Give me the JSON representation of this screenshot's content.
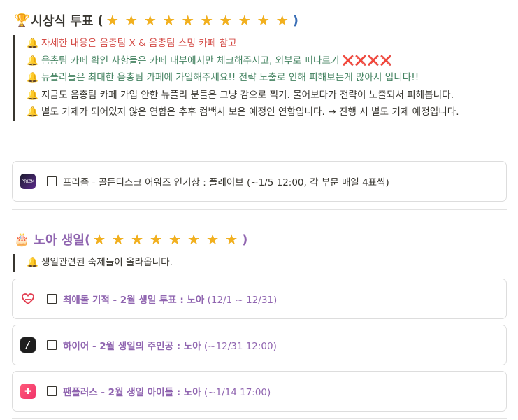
{
  "section1": {
    "emoji": "🏆",
    "title": "시상식 투표",
    "paren_open": "(",
    "paren_close": ")",
    "star_count": 10
  },
  "notes1": [
    {
      "text": "자세한 내용은 음총팀 X & 음총팀 스밍 카페 참고",
      "color": "red"
    },
    {
      "text": "음총팀 카페 확인 사항들은 카페 내부에서만 체크해주시고, 외부로 퍼나르기 ",
      "suffix": "❌❌❌❌",
      "color": "green"
    },
    {
      "text": "뉴플리들은 최대한 음총팀 카페에 가입해주세요!! 전략 노출로 인해 피해보는게 많아서 입니다!!",
      "color": "green"
    },
    {
      "text": "지금도 음총팀 카페 가입 안한 뉴플리 분들은 그냥 감으로 찍기. 물어보다가 전략이 노출되서 피해봅니다.",
      "color": "dark"
    },
    {
      "text": "별도 기제가 되어있지 않은 연합은 추후 컴백시 보은 예정인 연합입니다. → 진행 시 별도 기제 예정입니다.",
      "color": "dark"
    }
  ],
  "card1": {
    "app": "PRIZM",
    "text": "프리즘 - 골든디스크 어워즈 인기상 : 플레이브 (~1/5 12:00, 각 부문 매일 4표씩)"
  },
  "section2": {
    "emoji": "🎂",
    "title": "노아 생일",
    "paren_open": "(",
    "paren_close": ")",
    "star_count": 8
  },
  "notes2": [
    {
      "text": "생일관련된 숙제들이 올라옵니다.",
      "color": "dark"
    }
  ],
  "cards2": [
    {
      "icon": "heart-icon",
      "bold": "최애돌 기적 - 2월 생일 투표 : 노아",
      "light": " (12/1 ~ 12/31)"
    },
    {
      "icon": "hiore-icon",
      "bold": "하이어 - 2월 생일의 주인공 : 노아",
      "light": " (~12/31 12:00)"
    },
    {
      "icon": "fanplus-icon",
      "bold": "팬플러스 - 2월 생일 아이돌 : 노아",
      "light": " (~1/14 17:00)"
    }
  ],
  "colors": {
    "red": "#d44c47",
    "green": "#448361",
    "purple": "#9065b0",
    "star": "#f2b01e"
  }
}
